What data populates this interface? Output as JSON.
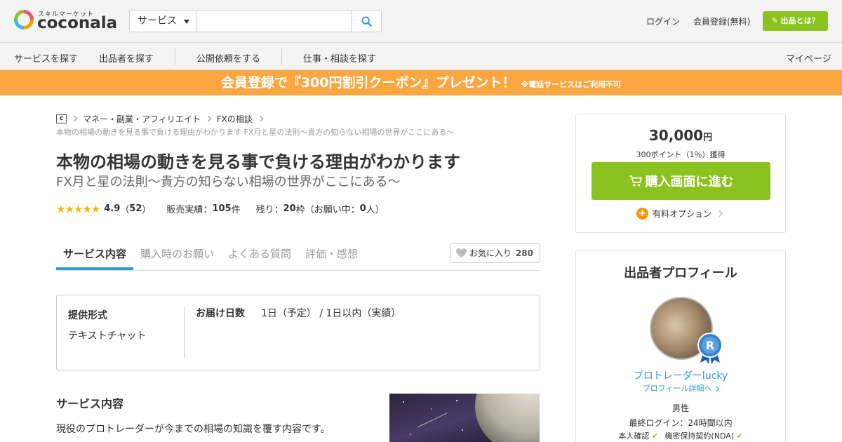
{
  "header": {
    "logo_sub": "スキルマーケット",
    "logo_text": "coconala",
    "search_category": "サービス",
    "search_placeholder": "",
    "login": "ログイン",
    "register": "会員登録(無料)",
    "sell_button": "出品とは？"
  },
  "nav": {
    "items": [
      "サービスを探す",
      "出品者を探す",
      "公開依頼をする",
      "仕事・相談を探す"
    ],
    "mypage": "マイページ"
  },
  "banner": {
    "main": "会員登録で『300円割引クーポン』プレゼント！",
    "note": "※電話サービスはご利用不可"
  },
  "breadcrumb": {
    "home": "c",
    "items": [
      "マネー・副業・アフィリエイト",
      "FXの相談"
    ],
    "sub": "本物の相場の動きを見る事で負ける理由がわかります FX月と星の法則～貴方の知らない相場の世界がここにある～"
  },
  "service": {
    "title": "本物の相場の動きを見る事で負ける理由がわかります",
    "subtitle": "FX月と星の法則～貴方の知らない相場の世界がここにある～",
    "stars": "★★★★★",
    "rating": "4.9",
    "review_count": "52",
    "sales_label": "販売実績：",
    "sales_value": "105",
    "sales_unit": "件",
    "remaining_label": "残り：",
    "remaining_value": "20",
    "remaining_mid": "枠（お願い中：",
    "pending_value": "0",
    "remaining_end": "人）"
  },
  "tabs": [
    "サービス内容",
    "購入時のお願い",
    "よくある質問",
    "評価・感想"
  ],
  "favorite": {
    "label": "お気に入り",
    "count": "280"
  },
  "spec": {
    "format_label": "提供形式",
    "format_value": "テキストチャット",
    "delivery_label": "お届け日数",
    "delivery_value": "1日（予定） / 1日以内（実績）"
  },
  "content": {
    "heading": "サービス内容",
    "body": "現役のプロトレーダーが今までの相場の知識を覆す内容です。"
  },
  "purchase": {
    "price": "30,000",
    "yen": "円",
    "points": "300ポイント（1％）獲得",
    "buy_button": "購入画面に進む",
    "option": "有料オプション"
  },
  "profile": {
    "title": "出品者プロフィール",
    "name": "プロトレーダーlucky",
    "detail_link": "プロフィール詳細へ",
    "gender": "男性",
    "last_login": "最終ログイン：24時間以内",
    "verify_identity": "本人確認",
    "verify_nda": "機密保持契約(NDA)"
  },
  "colors": {
    "accent_green": "#8cc21f",
    "banner_orange": "#fba641",
    "link_blue": "#2c9bd6",
    "star": "#f5b800"
  }
}
